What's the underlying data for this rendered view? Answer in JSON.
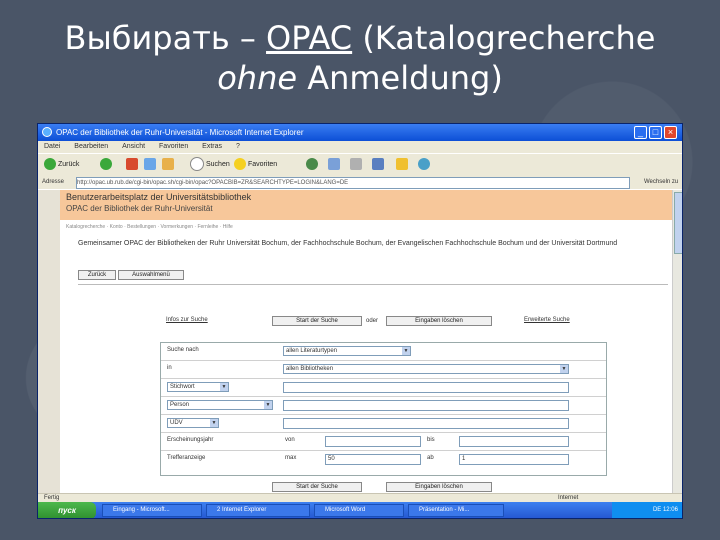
{
  "slide": {
    "title_part1": "Выбирать – ",
    "title_link": "OPAC",
    "title_part2": " (Katalogrecherche",
    "title_line2_italic": "ohne",
    "title_line2_rest": " Anmeldung)"
  },
  "window": {
    "title": "OPAC der Bibliothek der Ruhr-Universität - Microsoft Internet Explorer",
    "controls": [
      "_",
      "□",
      "×"
    ]
  },
  "menubar": {
    "items": [
      "Datei",
      "Bearbeiten",
      "Ansicht",
      "Favoriten",
      "Extras",
      "?"
    ]
  },
  "toolbar": {
    "back": "Zurück",
    "search": "Suchen",
    "favorites": "Favoriten"
  },
  "address": {
    "label": "Adresse",
    "url": "http://opac.ub.rub.de/cgi-bin/opac.sh/cgi-bin/opac?OPACBIB=ZR&SEARCHTYPE=LOGIN&LANG=DE",
    "go": "Wechseln zu"
  },
  "page": {
    "header_line1": "Benutzerarbeitsplatz der Universitätsbibliothek",
    "header_line2": "OPAC der Bibliothek der Ruhr-Universität",
    "subtext": "Katalogrecherche · Konto · Bestellungen · Vormerkungen · Fernleihe · Hilfe",
    "heading": "Gemeinsamer OPAC der Bibliotheken der Ruhr Universität Bochum, der Fachhochschule Bochum, der Evangelischen Fachhochschule Bochum und der Universität Dortmund",
    "btn_back": "Zurück",
    "btn_selection": "Auswahlmenü",
    "link_suchtipps": "Infos zur Suche",
    "btn_start": "Start der Suche",
    "oder": "oder",
    "btn_clear": "Eingaben löschen",
    "link_extended": "Erweiterte Suche",
    "form": {
      "row1_label": "Suche nach",
      "row1_select": "allen Literaturtypen",
      "row2_label": "in",
      "row2_select": "allen Bibliotheken",
      "row3_select": "Stichwort",
      "row4_select": "Person",
      "row5_select": "UDV",
      "row6_label": "Erscheinungsjahr",
      "row6_von": "von",
      "row6_bis": "bis",
      "row7_label": "Trefferanzeige",
      "row7_max": "max",
      "row7_value": "50",
      "row7_ab": "ab",
      "row7_ab_value": "1"
    },
    "btn_start2": "Start der Suche",
    "btn_clear2": "Eingaben löschen"
  },
  "statusbar": {
    "left": "Fertig",
    "right": "Internet"
  },
  "taskbar": {
    "start": "пуск",
    "tasks": [
      "Eingang - Microsoft...",
      "2 Internet Explorer",
      "Microsoft Word",
      "Präsentation - Mi..."
    ],
    "clock": "DE  12:06"
  }
}
